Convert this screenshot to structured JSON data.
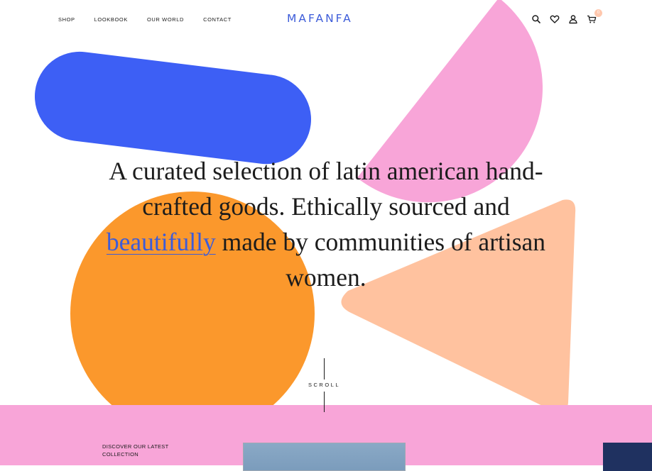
{
  "nav": {
    "links": [
      "SHOP",
      "LOOKBOOK",
      "OUR WORLD",
      "CONTACT"
    ],
    "logo": "MAFANFA",
    "icons": [
      "search-icon",
      "heart-icon",
      "user-icon",
      "cart-icon"
    ],
    "cart_count": "0"
  },
  "hero": {
    "text_before": "A curated selection of latin american hand-crafted goods. Ethically sourced and ",
    "highlight": "beautifully",
    "text_after": " made by communities of artisan women."
  },
  "scroll": {
    "label": "SCROLL"
  },
  "collection": {
    "discover_label": "DISCOVER OUR LATEST COLLECTION"
  },
  "colors": {
    "blue": "#3d5ff5",
    "pink": "#f8a5d8",
    "orange": "#fb982c",
    "peach": "#ffc29f",
    "logo_blue": "#3d5cd9",
    "navy": "#1f3160"
  }
}
